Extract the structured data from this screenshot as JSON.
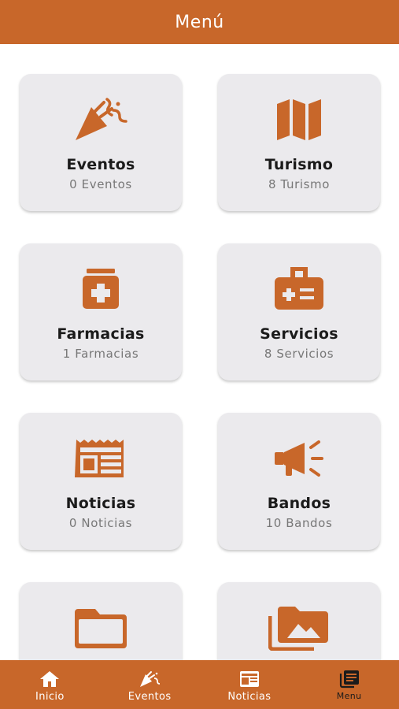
{
  "header": {
    "title": "Menú"
  },
  "colors": {
    "accent": "#c8672a",
    "card_bg": "#ebeaed",
    "tab_active": "#1b1b1b"
  },
  "menu_items": [
    {
      "title": "Eventos",
      "count": "0 Eventos",
      "icon": "party-popper-icon"
    },
    {
      "title": "Turismo",
      "count": "8 Turismo",
      "icon": "map-icon"
    },
    {
      "title": "Farmacias",
      "count": "1 Farmacias",
      "icon": "pharmacy-icon"
    },
    {
      "title": "Servicios",
      "count": "8 Servicios",
      "icon": "medical-kit-icon"
    },
    {
      "title": "Noticias",
      "count": "0 Noticias",
      "icon": "newspaper-icon"
    },
    {
      "title": "Bandos",
      "count": "10 Bandos",
      "icon": "megaphone-icon"
    },
    {
      "title": "",
      "count": "",
      "icon": "folder-icon"
    },
    {
      "title": "",
      "count": "",
      "icon": "photo-gallery-icon"
    }
  ],
  "tabbar": {
    "items": [
      {
        "label": "Inicio",
        "icon": "home-icon",
        "active": false
      },
      {
        "label": "Eventos",
        "icon": "party-popper-icon",
        "active": false
      },
      {
        "label": "Noticias",
        "icon": "newspaper-icon",
        "active": false
      },
      {
        "label": "Menu",
        "icon": "menu-list-icon",
        "active": true
      }
    ]
  }
}
